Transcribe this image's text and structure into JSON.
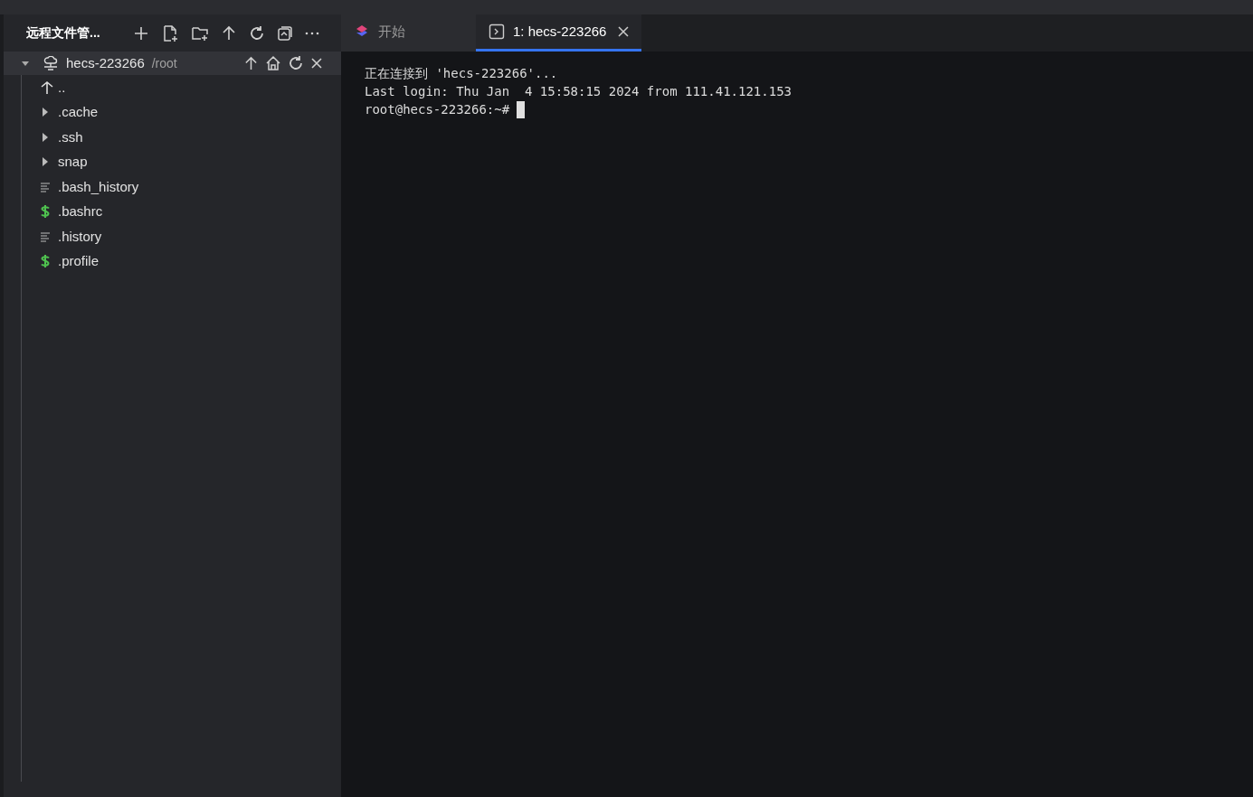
{
  "sidebar": {
    "title": "远程文件管...",
    "root": {
      "name": "hecs-223266",
      "path": "/root",
      "expanded": true,
      "children": [
        {
          "name": "..",
          "kind": "up"
        },
        {
          "name": ".cache",
          "kind": "folder"
        },
        {
          "name": ".ssh",
          "kind": "folder"
        },
        {
          "name": "snap",
          "kind": "folder"
        },
        {
          "name": ".bash_history",
          "kind": "text"
        },
        {
          "name": ".bashrc",
          "kind": "shell"
        },
        {
          "name": ".history",
          "kind": "text"
        },
        {
          "name": ".profile",
          "kind": "shell"
        }
      ]
    }
  },
  "tabs": [
    {
      "label": "开始",
      "kind": "start",
      "selected": false
    },
    {
      "label": "1: hecs-223266",
      "kind": "terminal",
      "selected": true
    }
  ],
  "terminal": {
    "lines": [
      "正在连接到 'hecs-223266'...",
      "Last login: Thu Jan  4 15:58:15 2024 from 111.41.121.153"
    ],
    "prompt": "root@hecs-223266:~#"
  }
}
